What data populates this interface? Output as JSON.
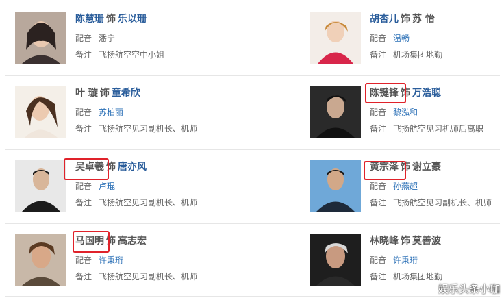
{
  "labels": {
    "dub": "配音",
    "note": "备注",
    "as": "饰"
  },
  "cards": [
    {
      "actor": "陈慧珊",
      "role": "乐以珊",
      "dub": "潘宁",
      "note": "飞扬航空空中小姐"
    },
    {
      "actor": "胡杏儿",
      "role": "苏 怡",
      "dub": "温畅",
      "note": "机场集团地勤"
    },
    {
      "actor": "叶 璇",
      "role": "童希欣",
      "dub": "苏柏丽",
      "note": "飞扬航空见习副机长、机师"
    },
    {
      "actor": "陈键锋",
      "role": "万浩聪",
      "dub": "黎泓和",
      "note": "飞扬航空见习机师后离职"
    },
    {
      "actor": "吴卓羲",
      "role": "唐亦风",
      "dub": "卢琨",
      "note": "飞扬航空见习副机长、机师"
    },
    {
      "actor": "黄宗泽",
      "role": "谢立豪",
      "dub": "孙燕超",
      "note": "飞扬航空见习副机长、机师"
    },
    {
      "actor": "马国明",
      "role": "高志宏",
      "dub": "许秉珩",
      "note": "飞扬航空见习副机长、机师"
    },
    {
      "actor": "林晓峰",
      "role": "莫善波",
      "dub": "许秉珩",
      "note": "机场集团地勤"
    }
  ],
  "watermark": "娱乐头条小珈",
  "colors": {
    "link": "#2a5d9b",
    "highlight_box": "#e0222a"
  }
}
